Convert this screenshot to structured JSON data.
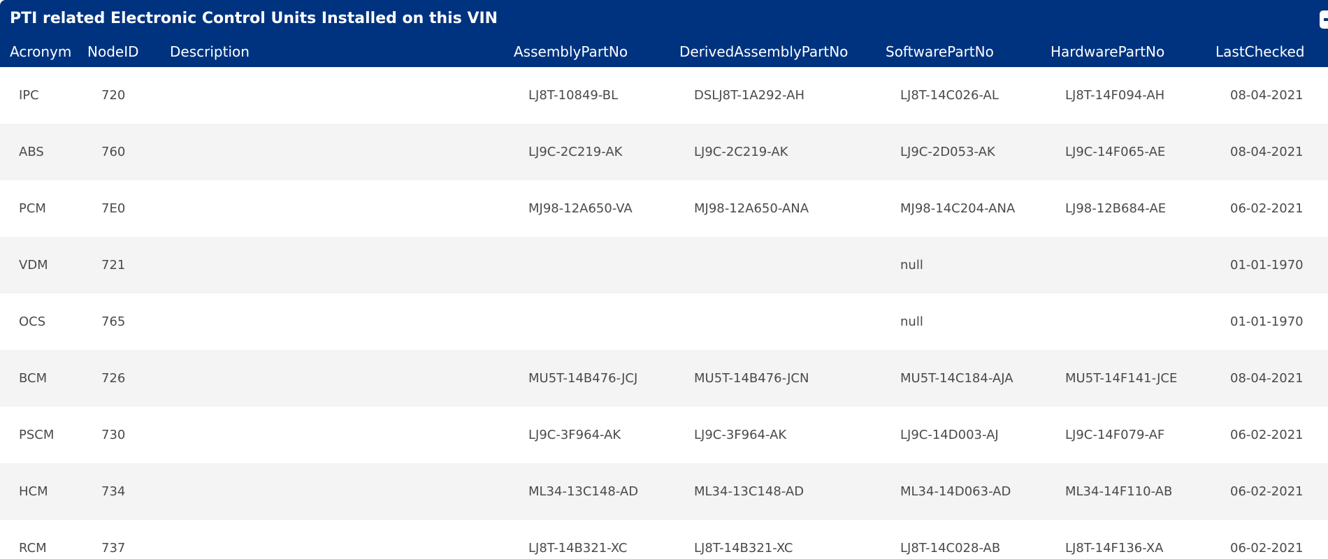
{
  "panel": {
    "title": "PTI related Electronic Control Units Installed on this VIN",
    "toggle_icon": "minus-icon"
  },
  "colors": {
    "header_bg": "#00337f",
    "row_alt_bg": "#f4f4f4",
    "text": "#4a4a4a"
  },
  "table": {
    "headers": {
      "acronym": "Acronym",
      "node_id": "NodeID",
      "description": "Description",
      "assembly": "AssemblyPartNo",
      "derived": "DerivedAssemblyPartNo",
      "software": "SoftwarePartNo",
      "hardware": "HardwarePartNo",
      "last_checked": "LastChecked"
    },
    "rows": [
      {
        "acronym": "IPC",
        "node_id": "720",
        "description": "",
        "assembly": "LJ8T-10849-BL",
        "derived": "DSLJ8T-1A292-AH",
        "software": "LJ8T-14C026-AL",
        "hardware": "LJ8T-14F094-AH",
        "last_checked": "08-04-2021"
      },
      {
        "acronym": "ABS",
        "node_id": "760",
        "description": "",
        "assembly": "LJ9C-2C219-AK",
        "derived": "LJ9C-2C219-AK",
        "software": "LJ9C-2D053-AK",
        "hardware": "LJ9C-14F065-AE",
        "last_checked": "08-04-2021"
      },
      {
        "acronym": "PCM",
        "node_id": "7E0",
        "description": "",
        "assembly": "MJ98-12A650-VA",
        "derived": "MJ98-12A650-ANA",
        "software": "MJ98-14C204-ANA",
        "hardware": "LJ98-12B684-AE",
        "last_checked": "06-02-2021"
      },
      {
        "acronym": "VDM",
        "node_id": "721",
        "description": "",
        "assembly": "",
        "derived": "",
        "software": "null",
        "hardware": "",
        "last_checked": "01-01-1970"
      },
      {
        "acronym": "OCS",
        "node_id": "765",
        "description": "",
        "assembly": "",
        "derived": "",
        "software": "null",
        "hardware": "",
        "last_checked": "01-01-1970"
      },
      {
        "acronym": "BCM",
        "node_id": "726",
        "description": "",
        "assembly": "MU5T-14B476-JCJ",
        "derived": "MU5T-14B476-JCN",
        "software": "MU5T-14C184-AJA",
        "hardware": "MU5T-14F141-JCE",
        "last_checked": "08-04-2021"
      },
      {
        "acronym": "PSCM",
        "node_id": "730",
        "description": "",
        "assembly": "LJ9C-3F964-AK",
        "derived": "LJ9C-3F964-AK",
        "software": "LJ9C-14D003-AJ",
        "hardware": "LJ9C-14F079-AF",
        "last_checked": "06-02-2021"
      },
      {
        "acronym": "HCM",
        "node_id": "734",
        "description": "",
        "assembly": "ML34-13C148-AD",
        "derived": "ML34-13C148-AD",
        "software": "ML34-14D063-AD",
        "hardware": "ML34-14F110-AB",
        "last_checked": "06-02-2021"
      },
      {
        "acronym": "RCM",
        "node_id": "737",
        "description": "",
        "assembly": "LJ8T-14B321-XC",
        "derived": "LJ8T-14B321-XC",
        "software": "LJ8T-14C028-AB",
        "hardware": "LJ8T-14F136-XA",
        "last_checked": "06-02-2021"
      }
    ]
  }
}
